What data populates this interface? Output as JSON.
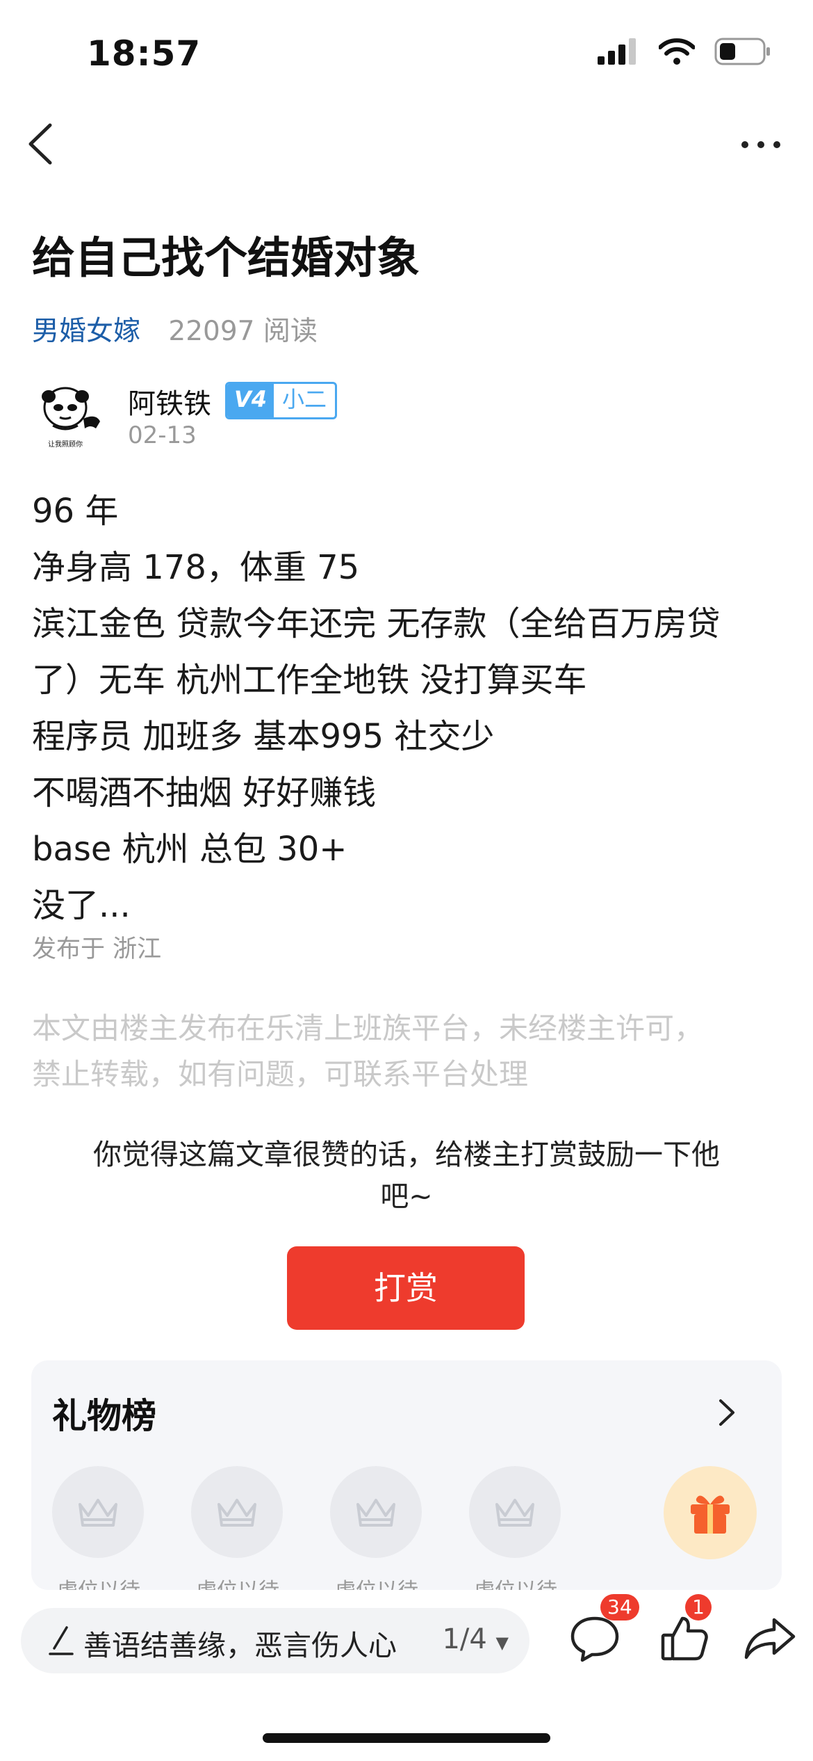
{
  "status_bar": {
    "time": "18:57"
  },
  "post": {
    "title": "给自己找个结婚对象",
    "topic": "男婚女嫁",
    "reads": "22097 阅读",
    "author": {
      "name": "阿铁铁",
      "level": "V4",
      "role": "小二",
      "date": "02-13",
      "avatar_caption": "让我照顾你"
    },
    "content": [
      "96 年",
      "净身高 178，体重 75",
      "滨江金色 贷款今年还完 无存款（全给百万房贷",
      "了）无车 杭州工作全地铁 没打算买车",
      "程序员 加班多 基本995 社交少",
      "不喝酒不抽烟 好好赚钱",
      "base 杭州 总包 30+",
      "没了..."
    ],
    "location": "发布于 浙江",
    "copyright": [
      "本文由楼主发布在乐清上班族平台，未经楼主许可，",
      "禁止转载，如有问题，可联系平台处理"
    ]
  },
  "reward": {
    "tip_line1": "你觉得这篇文章很赞的话，给楼主打赏鼓励一下他",
    "tip_line2": "吧~",
    "button_label": "打赏"
  },
  "gift_board": {
    "title": "礼物榜",
    "slots": [
      "虚位以待",
      "虚位以待",
      "虚位以待",
      "虚位以待"
    ]
  },
  "bottom_bar": {
    "comment_placeholder": "善语结善缘，恶言伤人心",
    "page_indicator": "1/4",
    "comment_count": "34",
    "like_count": "1"
  },
  "colors": {
    "accent_red": "#ee3b2d",
    "link_blue": "#1d5ea8",
    "badge_blue": "#4aa8f0"
  },
  "icons": [
    "back-icon",
    "more-icon",
    "chevron-right-icon",
    "crown-icon",
    "gift-icon",
    "pen-icon",
    "comment-icon",
    "like-icon",
    "share-icon",
    "signal-icon",
    "wifi-icon",
    "battery-icon"
  ]
}
